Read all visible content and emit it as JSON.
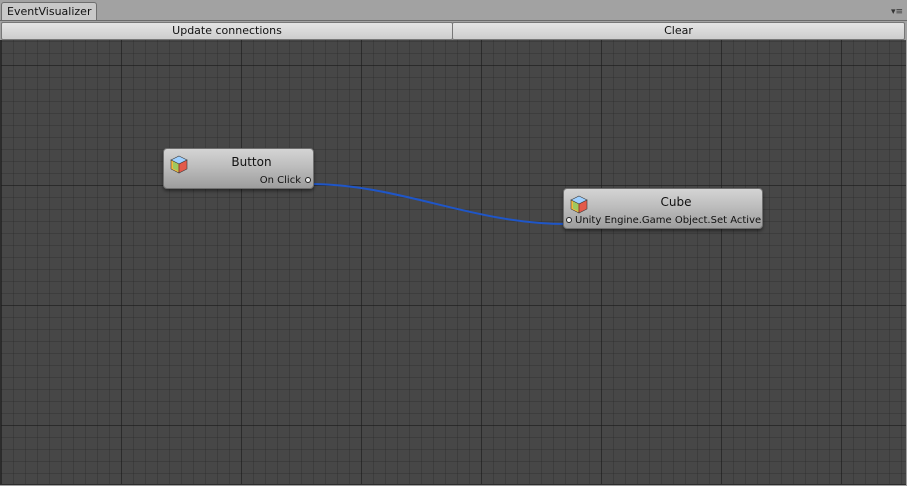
{
  "window": {
    "tab_title": "EventVisualizer",
    "menu_glyph": "▾≡"
  },
  "toolbar": {
    "update_label": "Update connections",
    "clear_label": "Clear"
  },
  "graph": {
    "nodes": [
      {
        "title": "Button",
        "icon": "gameobject-cube-icon",
        "port_label": "On Click",
        "port_side": "output"
      },
      {
        "title": "Cube",
        "icon": "gameobject-cube-icon",
        "port_label": "Unity Engine.Game Object.Set Active",
        "port_side": "input"
      }
    ],
    "connection_color": "#1f56c8"
  }
}
